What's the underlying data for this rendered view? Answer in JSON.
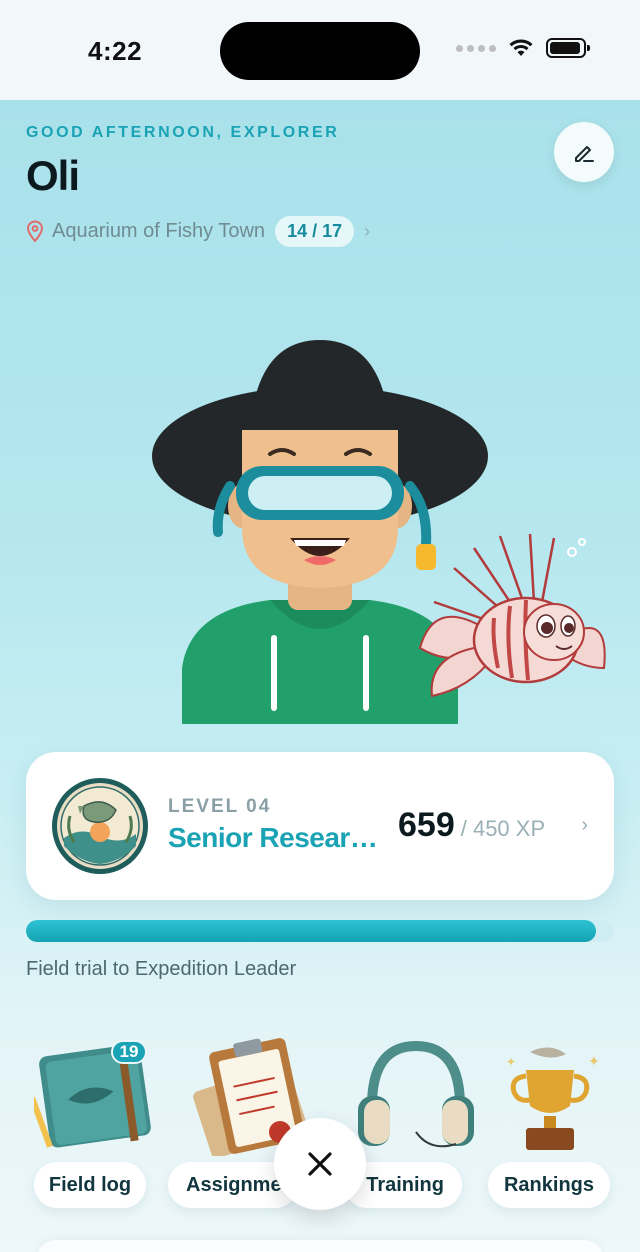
{
  "status_bar": {
    "time": "4:22"
  },
  "header": {
    "greeting": "GOOD AFTERNOON, EXPLORER",
    "name": "Oli",
    "location": "Aquarium of Fishy Town",
    "location_progress": "14 / 17"
  },
  "level_card": {
    "level_label": "LEVEL 04",
    "title": "Senior Researcher",
    "xp_current": "659",
    "xp_max": "/ 450 XP"
  },
  "progress": {
    "fraction": 0.97,
    "caption": "Field trial to Expedition Leader"
  },
  "tiles": [
    {
      "label": "Field log",
      "icon": "field-log-notebook-icon",
      "badge": "19"
    },
    {
      "label": "Assignments",
      "icon": "assignments-clipboard-icon"
    },
    {
      "label": "Training",
      "icon": "training-headphones-icon"
    },
    {
      "label": "Rankings",
      "icon": "rankings-trophy-icon"
    }
  ],
  "colors": {
    "accent": "#1aa3b4",
    "background_top": "#a9e1ea",
    "text_dark": "#0c1a1f"
  }
}
